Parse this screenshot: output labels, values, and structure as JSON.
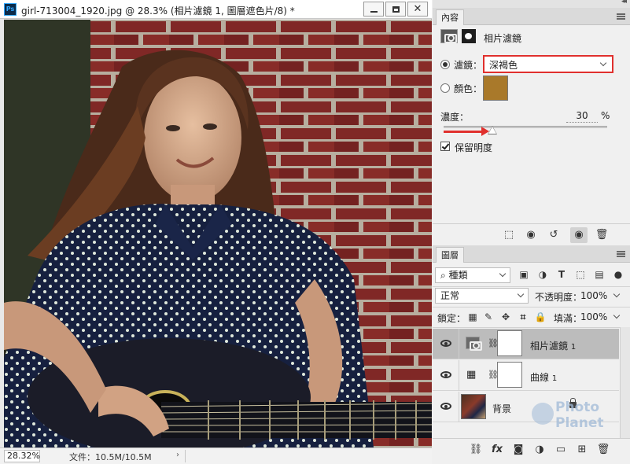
{
  "document": {
    "app_icon": "Ps",
    "title": "girl-713004_1920.jpg @ 28.3% (相片濾鏡 1, 圖層遮色片/8) *",
    "zoom": "28.32%",
    "file_info": "文件：10.5M/10.5M",
    "status_arrow": "›"
  },
  "properties": {
    "tab_label": "內容",
    "title": "相片濾鏡",
    "filter_label": "濾鏡：",
    "filter_value": "深褐色",
    "color_label": "顏色：",
    "color_swatch": "#a9792a",
    "density_label": "濃度：",
    "density_value": "30",
    "density_unit": "%",
    "density_fraction": 0.3,
    "preserve_label": "保留明度",
    "collapse_glyph": "◂◂"
  },
  "layers": {
    "tab_label": "圖層",
    "filter_kind": "種類",
    "blend_mode": "正常",
    "opacity_label": "不透明度：",
    "opacity_value": "100%",
    "lock_label": "鎖定：",
    "fill_label": "填滿：",
    "fill_value": "100%",
    "rows": [
      {
        "name": "相片濾鏡",
        "suffix": "1"
      },
      {
        "name": "曲線",
        "suffix": "1"
      },
      {
        "name": "背景",
        "suffix": ""
      }
    ]
  },
  "watermark": {
    "line1": "Photo",
    "line2": "Planet"
  },
  "accent_colors": {
    "highlight": "#e0302d",
    "sepia": "#a9792a",
    "selected_row": "#bcbcbc"
  },
  "icons": {
    "layers_footer": [
      "link-icon",
      "fx-icon",
      "mask-icon",
      "adjustment-icon",
      "folder-icon",
      "new-layer-icon",
      "trash-icon"
    ],
    "prop_footer": [
      "clip-icon",
      "view-previous-icon",
      "reset-icon",
      "visibility-icon",
      "trash-icon"
    ]
  }
}
